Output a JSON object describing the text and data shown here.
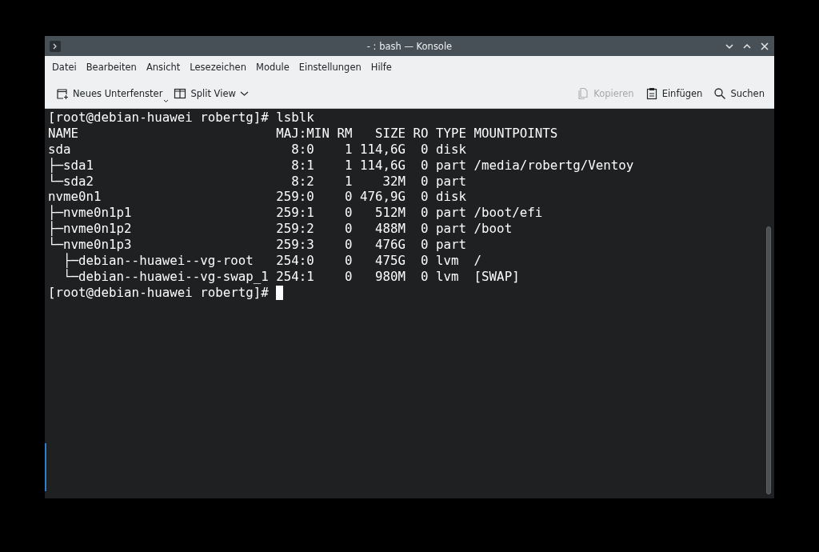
{
  "window": {
    "title": "- : bash — Konsole"
  },
  "menu": [
    "Datei",
    "Bearbeiten",
    "Ansicht",
    "Lesezeichen",
    "Module",
    "Einstellungen",
    "Hilfe"
  ],
  "toolbar": {
    "left": [
      {
        "label": "Neues Unterfenster",
        "kind": "new-tab",
        "disabled": false
      },
      {
        "label": "Split View",
        "kind": "split",
        "disabled": false
      }
    ],
    "right": [
      {
        "label": "Kopieren",
        "kind": "copy",
        "disabled": true
      },
      {
        "label": "Einfügen",
        "kind": "paste",
        "disabled": false
      },
      {
        "label": "Suchen",
        "kind": "search",
        "disabled": false
      }
    ]
  },
  "terminal": {
    "lines": [
      "[root@debian-huawei robertg]# lsblk",
      "NAME                          MAJ:MIN RM   SIZE RO TYPE MOUNTPOINTS",
      "sda                             8:0    1 114,6G  0 disk",
      "├─sda1                          8:1    1 114,6G  0 part /media/robertg/Ventoy",
      "└─sda2                          8:2    1    32M  0 part",
      "nvme0n1                       259:0    0 476,9G  0 disk",
      "├─nvme0n1p1                   259:1    0   512M  0 part /boot/efi",
      "├─nvme0n1p2                   259:2    0   488M  0 part /boot",
      "└─nvme0n1p3                   259:3    0   476G  0 part",
      "  ├─debian--huawei--vg-root   254:0    0   475G  0 lvm  /",
      "  └─debian--huawei--vg-swap_1 254:1    0   980M  0 lvm  [SWAP]",
      "[root@debian-huawei robertg]# "
    ],
    "cursor": true
  }
}
